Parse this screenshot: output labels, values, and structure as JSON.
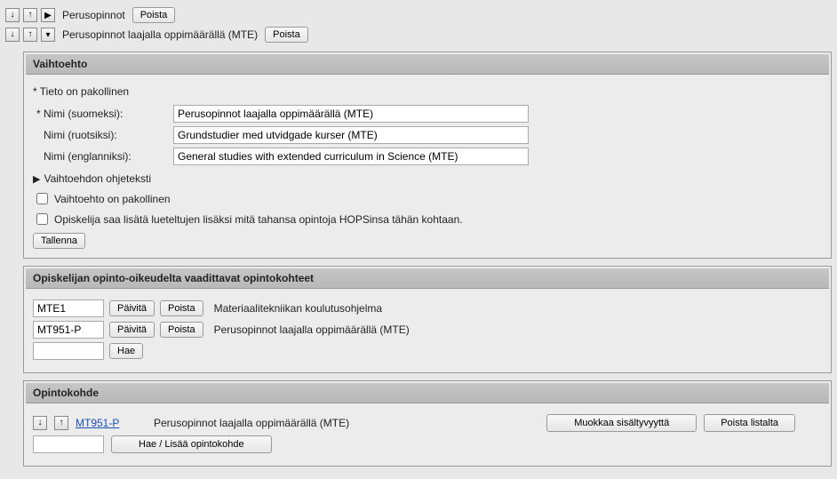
{
  "nodes": [
    {
      "title": "Perusopinnot",
      "remove": "Poista",
      "expanded": false
    },
    {
      "title": "Perusopinnot laajalla oppimäärällä (MTE)",
      "remove": "Poista",
      "expanded": true
    }
  ],
  "vaihtoehto": {
    "header": "Vaihtoehto",
    "required_notice": "Tieto on pakollinen",
    "fields": {
      "fi": {
        "label": "Nimi (suomeksi):",
        "value": "Perusopinnot laajalla oppimäärällä (MTE)"
      },
      "sv": {
        "label": "Nimi (ruotsiksi):",
        "value": "Grundstudier med utvidgade kurser (MTE)"
      },
      "en": {
        "label": "Nimi (englanniksi):",
        "value": "General studies with extended curriculum in Science (MTE)"
      }
    },
    "help_expander": "Vaihtoehdon ohjeteksti",
    "cb_mandatory": "Vaihtoehto on pakollinen",
    "cb_anycourse": "Opiskelija saa lisätä lueteltujen lisäksi mitä tahansa opintoja HOPSinsa tähän kohtaan.",
    "save": "Tallenna"
  },
  "vaaditut": {
    "header": "Opiskelijan opinto-oikeudelta vaadittavat opintokohteet",
    "rows": [
      {
        "code": "MTE1",
        "desc": "Materiaalitekniikan koulutusohjelma"
      },
      {
        "code": "MT951-P",
        "desc": "Perusopinnot laajalla oppimäärällä (MTE)"
      }
    ],
    "update": "Päivitä",
    "remove": "Poista",
    "search": "Hae"
  },
  "opintokohde": {
    "header": "Opintokohde",
    "row": {
      "code": "MT951-P",
      "title": "Perusopinnot laajalla oppimäärällä (MTE)"
    },
    "edit": "Muokkaa sisältyvyyttä",
    "remove": "Poista listalta",
    "add": "Hae / Lisää opintokohde"
  }
}
